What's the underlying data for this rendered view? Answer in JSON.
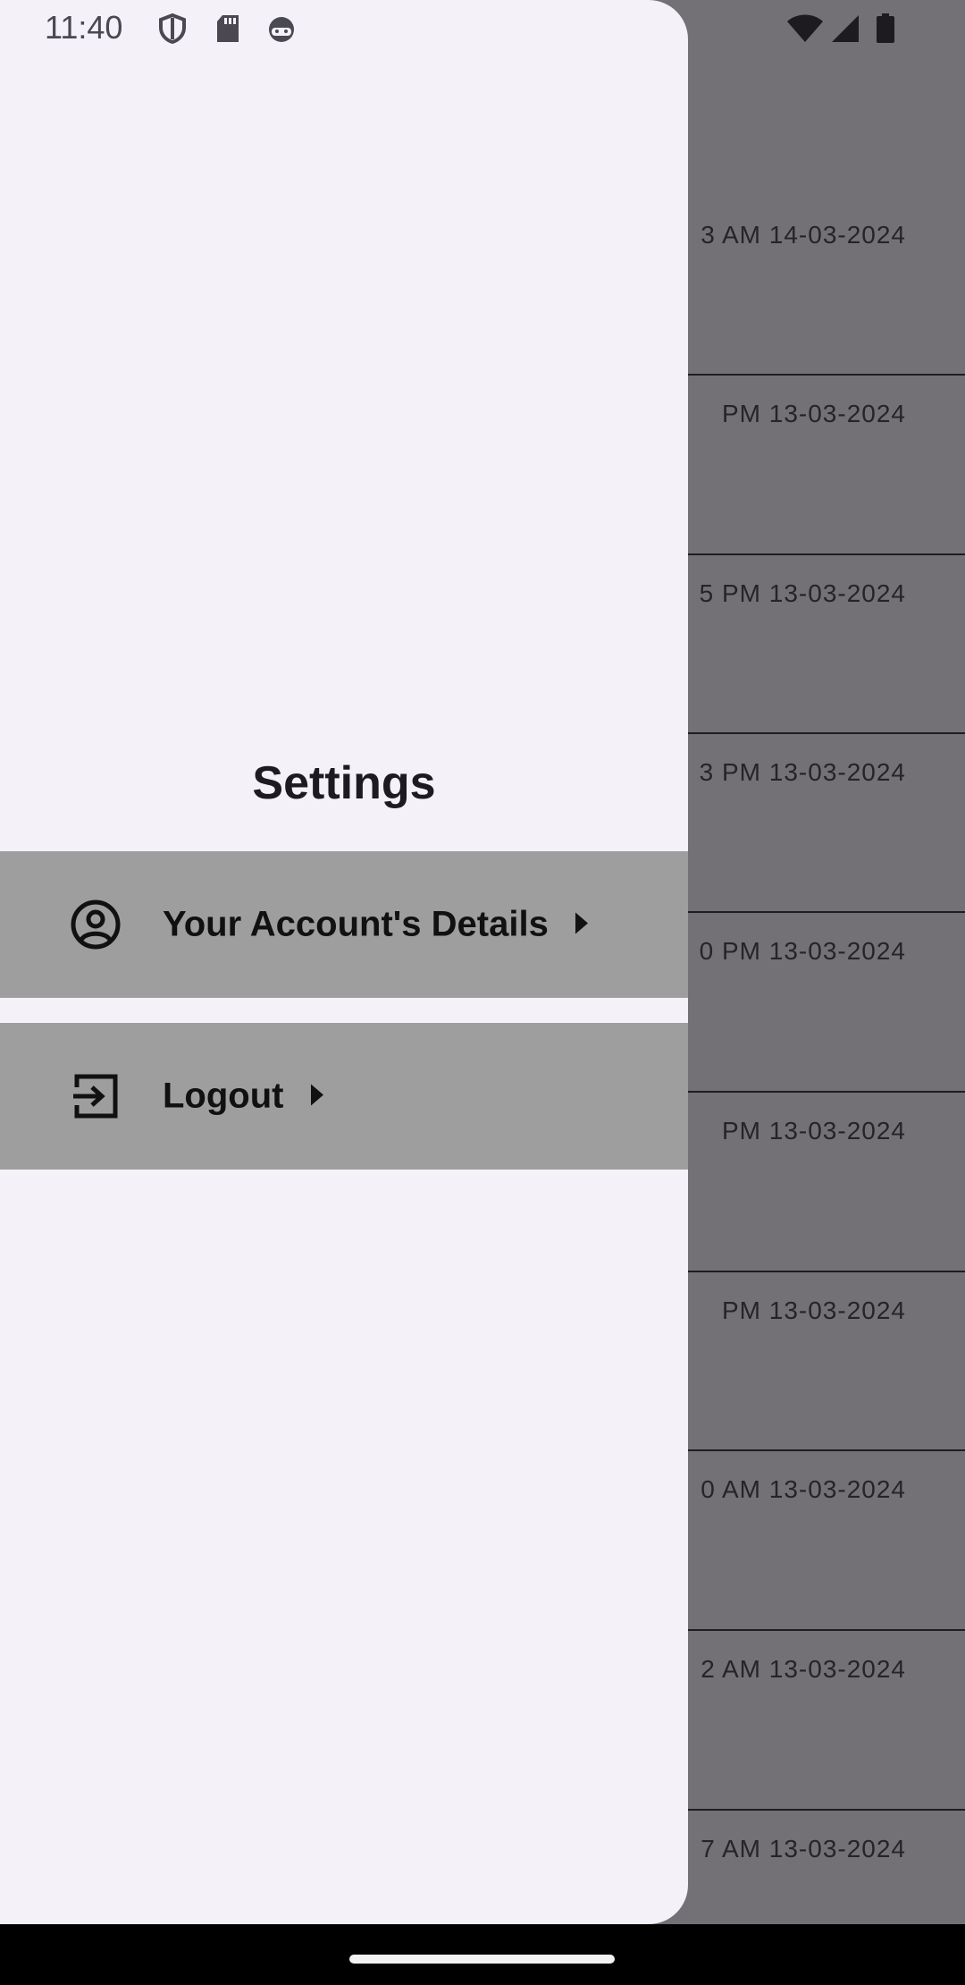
{
  "status_bar": {
    "time": "11:40",
    "left_icons": [
      "shield-icon",
      "sd-card-icon",
      "android-face-icon"
    ],
    "right_icons": [
      "wifi-icon",
      "signal-icon",
      "battery-icon"
    ]
  },
  "background_list": {
    "rows": [
      {
        "text": "3 AM 14-03-2024"
      },
      {
        "text": "PM 13-03-2024"
      },
      {
        "text": "5 PM 13-03-2024"
      },
      {
        "text": "3 PM 13-03-2024"
      },
      {
        "text": "0 PM 13-03-2024"
      },
      {
        "text": "PM 13-03-2024"
      },
      {
        "text": "PM 13-03-2024"
      },
      {
        "text": "0 AM 13-03-2024"
      },
      {
        "text": "2 AM 13-03-2024"
      },
      {
        "text": "7 AM 13-03-2024"
      }
    ]
  },
  "drawer": {
    "title": "Settings",
    "items": [
      {
        "label": "Your Account's Details",
        "icon": "account-circle-icon"
      },
      {
        "label": "Logout",
        "icon": "logout-icon"
      }
    ],
    "item_background": "#9e9e9e",
    "background": "#f5f1f8"
  },
  "colors": {
    "scrim": "#737175",
    "text_dark": "#1d1b20"
  }
}
